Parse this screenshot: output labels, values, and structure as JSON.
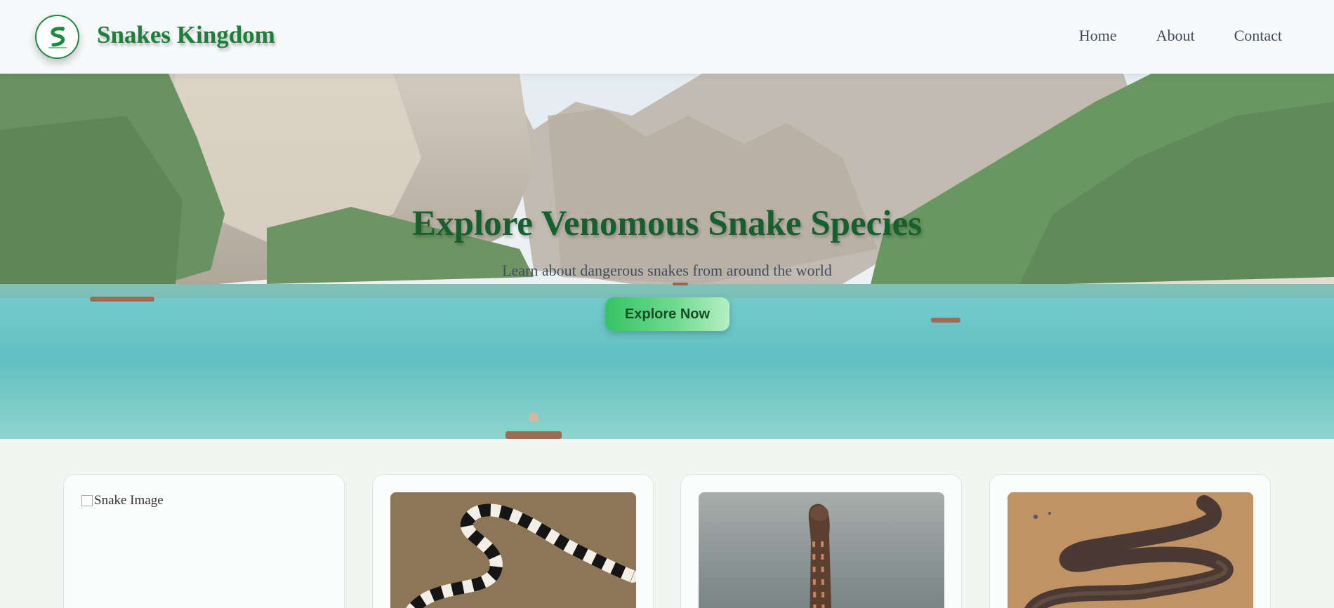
{
  "header": {
    "brand": "Snakes Kingdom",
    "logo_icon": "snake-logo-icon",
    "nav": [
      {
        "label": "Home"
      },
      {
        "label": "About"
      },
      {
        "label": "Contact"
      }
    ]
  },
  "hero": {
    "title": "Explore Venomous Snake Species",
    "subtitle": "Learn about dangerous snakes from around the world",
    "button_label": "Explore Now",
    "background": "mountain-lake-photo"
  },
  "cards": [
    {
      "image_alt": "Snake Image",
      "image_loaded": false
    },
    {
      "image": "banded-krait-photo",
      "image_loaded": true
    },
    {
      "image": "cobra-photo",
      "image_loaded": true
    },
    {
      "image": "brown-snake-photo",
      "image_loaded": true
    }
  ],
  "colors": {
    "brand_green": "#1c7f3a",
    "hero_title_green": "#16602e",
    "button_gradient_start": "#35c465",
    "button_gradient_end": "#b6efc4",
    "page_background": "#f1f6f3"
  }
}
